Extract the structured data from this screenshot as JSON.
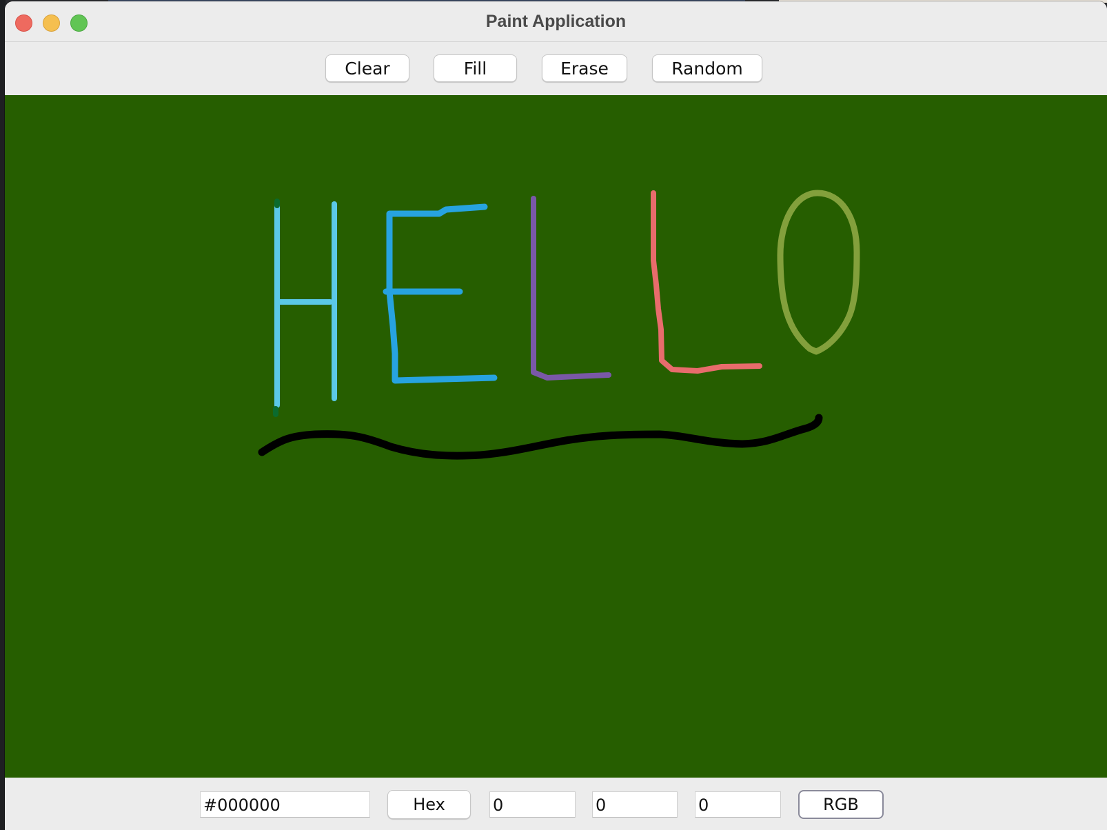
{
  "window": {
    "title": "Paint Application"
  },
  "toolbar": {
    "clear_label": "Clear",
    "fill_label": "Fill",
    "erase_label": "Erase",
    "random_label": "Random"
  },
  "canvas": {
    "background_color": "#265e00",
    "stroke_colors": {
      "h_left": "#5bc8e8",
      "h_right": "#5bc8e8",
      "h_dot": "#0b6b2e",
      "e": "#27a3e0",
      "l1": "#7a58a8",
      "l2": "#e86c6c",
      "o": "#83a03c",
      "underline": "#000000"
    }
  },
  "bottom": {
    "hex_value": "#000000",
    "hex_button_label": "Hex",
    "r_value": "0",
    "g_value": "0",
    "b_value": "0",
    "rgb_button_label": "RGB"
  }
}
